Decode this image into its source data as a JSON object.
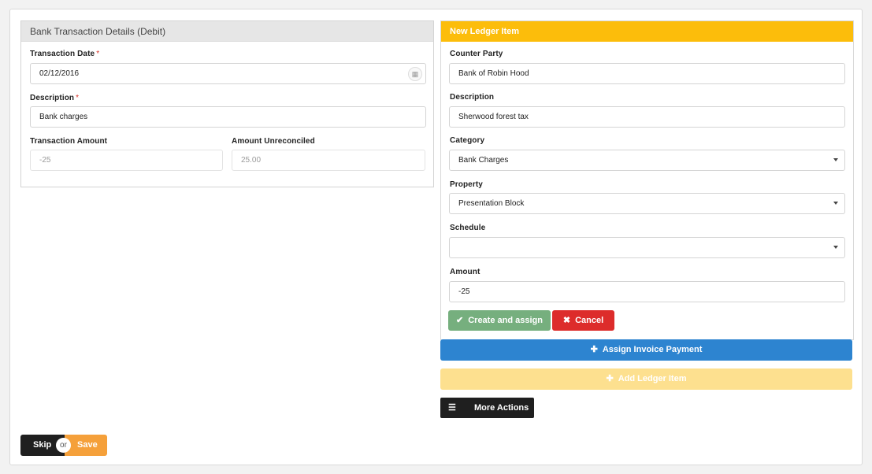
{
  "left_panel": {
    "title": "Bank Transaction Details (Debit)",
    "transaction_date_label": "Transaction Date",
    "transaction_date_value": "02/12/2016",
    "description_label": "Description",
    "description_value": "Bank charges",
    "transaction_amount_label": "Transaction Amount",
    "transaction_amount_value": "-25",
    "amount_unreconciled_label": "Amount Unreconciled",
    "amount_unreconciled_value": "25.00",
    "required_mark": "*"
  },
  "right_panel": {
    "title": "New Ledger Item",
    "counter_party_label": "Counter Party",
    "counter_party_value": "Bank of Robin Hood",
    "description_label": "Description",
    "description_value": "Sherwood forest tax",
    "category_label": "Category",
    "category_value": "Bank Charges",
    "property_label": "Property",
    "property_value": "Presentation Block",
    "schedule_label": "Schedule",
    "schedule_value": "",
    "amount_label": "Amount",
    "amount_value": "-25",
    "create_assign_label": "Create and assign",
    "cancel_label": "Cancel"
  },
  "actions": {
    "assign_invoice_label": "Assign Invoice Payment",
    "add_ledger_label": "Add Ledger Item",
    "more_actions_label": "More Actions",
    "skip_label": "Skip",
    "or_label": "or",
    "save_label": "Save"
  },
  "icons": {
    "calendar": "calendar-icon",
    "check": "check-icon",
    "close": "close-icon",
    "plus": "plus-icon",
    "sliders": "sliders-icon"
  },
  "colors": {
    "ledger_header": "#fcbd0b",
    "create_button": "#76af7e",
    "cancel_button": "#dd2c2b",
    "assign_button": "#2d84d0",
    "add_ledger_button": "#fde08f",
    "dark_button": "#1f1f1f",
    "save_button": "#f5a03a",
    "required": "#d9352a"
  }
}
